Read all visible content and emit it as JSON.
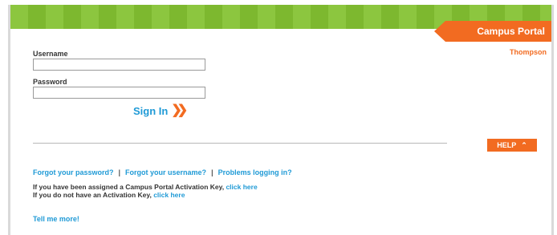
{
  "header": {
    "portal_title": "Campus Portal",
    "district_name": "Thompson"
  },
  "login": {
    "username_label": "Username",
    "username_value": "",
    "password_label": "Password",
    "password_value": "",
    "signin_label": "Sign In",
    "signin_icon": "double-chevron-right-icon"
  },
  "help": {
    "label": "HELP",
    "icon": "chevron-up-icon"
  },
  "links": {
    "forgot_password": "Forgot your password?",
    "forgot_username": "Forgot your username?",
    "problems": "Problems logging in?",
    "separator": "|"
  },
  "activation": {
    "line1_text": "If you have been assigned a Campus Portal Activation Key,",
    "line1_link": "click here",
    "line2_text": "If you do not have an Activation Key,",
    "line2_link": "click here"
  },
  "more": {
    "label": "Tell me more!"
  },
  "colors": {
    "accent_orange": "#f26b21",
    "link_blue": "#1f9ad6",
    "band_green": "#8cc63f"
  }
}
